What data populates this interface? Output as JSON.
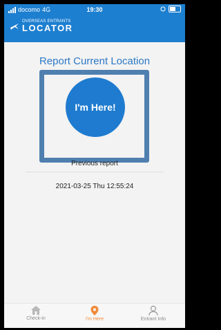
{
  "status_bar": {
    "carrier": "docomo",
    "network": "4G",
    "time": "19:30"
  },
  "header": {
    "logo_small": "OVERSEAS ENTRANTS",
    "logo_big": "LOCATOR"
  },
  "main": {
    "title": "Report Current Location",
    "im_here_label": "I'm Here!",
    "previous_report_label": "Previous report",
    "previous_report_time": "2021-03-25 Thu 12:55:24"
  },
  "tabs": [
    {
      "label": "Check-in",
      "icon": "house-icon",
      "active": false
    },
    {
      "label": "I'm Here",
      "icon": "location-pin-icon",
      "active": true
    },
    {
      "label": "Entrant Info",
      "icon": "person-icon",
      "active": false
    }
  ],
  "colors": {
    "header": "#1d7fd0",
    "title": "#2c78c5",
    "frame": "#4f7faf",
    "button": "#1f7bcf",
    "active_tab": "#f08a3a",
    "inactive_tab": "#8a8a8a"
  }
}
